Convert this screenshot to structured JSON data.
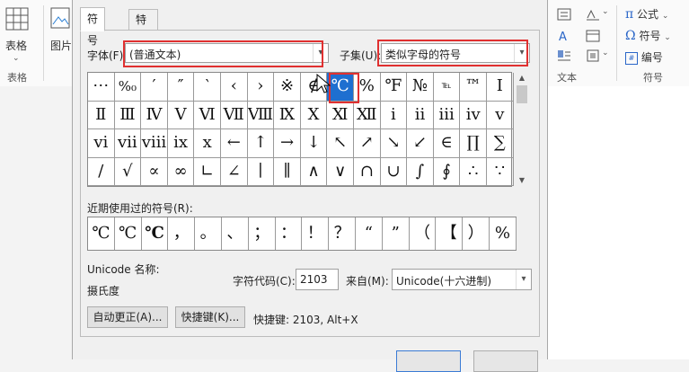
{
  "ribbon": {
    "left_table_label": "表格",
    "left_image_label": "图片",
    "left_group_label": "表格",
    "text_group_label": "文本",
    "symbol_group_label": "符号",
    "formula_label": "公式",
    "symbol_label": "符号",
    "number_label": "编号"
  },
  "dialog": {
    "tabs": [
      {
        "label": "符号"
      },
      {
        "label": "特殊字符(P)"
      }
    ],
    "font_label": "字体(F):",
    "font_value": "(普通文本)",
    "subset_label": "子集(U):",
    "subset_value": "类似字母的符号",
    "symbol_rows": [
      [
        "⋯",
        "%₀",
        "′",
        "″",
        "‵",
        "‹",
        "›",
        "※",
        "∉",
        "℃",
        "%",
        "℉",
        "№",
        "℡",
        "™",
        "I"
      ],
      [
        "Ⅱ",
        "Ⅲ",
        "Ⅳ",
        "Ⅴ",
        "Ⅵ",
        "Ⅶ",
        "Ⅷ",
        "Ⅸ",
        "Ⅹ",
        "Ⅺ",
        "Ⅻ",
        "ⅰ",
        "ⅱ",
        "ⅲ",
        "ⅳ",
        "ⅴ"
      ],
      [
        "ⅵ",
        "ⅶ",
        "ⅷ",
        "ⅸ",
        "ⅹ",
        "←",
        "↑",
        "→",
        "↓",
        "↖",
        "↗",
        "↘",
        "↙",
        "∈",
        "∏",
        "∑"
      ],
      [
        "∕",
        "√",
        "∝",
        "∞",
        "∟",
        "∠",
        "∣",
        "∥",
        "∧",
        "∨",
        "∩",
        "∪",
        "∫",
        "∮",
        "∴",
        "∵"
      ]
    ],
    "selected_symbol": "℃",
    "recent_label": "近期使用过的符号(R):",
    "recent_symbols": [
      "℃",
      "℃",
      "℃",
      "，",
      "。",
      "、",
      "；",
      "：",
      "！",
      "？",
      "“",
      "”",
      "（",
      "【",
      "）",
      "%"
    ],
    "unicode_name_label": "Unicode 名称:",
    "unicode_name_value": "摄氏度",
    "char_code_label": "字符代码(C):",
    "char_code_value": "2103",
    "from_label": "来自(M):",
    "from_value": "Unicode(十六进制)",
    "autocorrect_button": "自动更正(A)...",
    "shortcut_button": "快捷键(K)...",
    "shortcut_text": "快捷键: 2103, Alt+X"
  },
  "colors": {
    "selection": "#1e6fd0",
    "highlight_border": "#e03030"
  }
}
